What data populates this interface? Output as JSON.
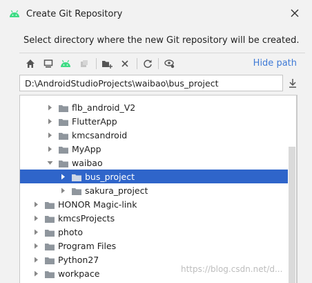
{
  "window": {
    "title": "Create Git Repository",
    "subtitle": "Select directory where the new Git repository will be created."
  },
  "toolbar": {
    "icons": [
      "home-icon",
      "desktop-icon",
      "android-project-icon",
      "module-icon",
      "new-folder-icon",
      "delete-icon",
      "refresh-icon",
      "show-hidden-icon"
    ],
    "hide_path_label": "Hide path"
  },
  "path": {
    "value": "D:\\AndroidStudioProjects\\waibao\\bus_project"
  },
  "tree": {
    "items": [
      {
        "label": "flb_android_V2",
        "expanded": false,
        "selected": false
      },
      {
        "label": "FlutterApp",
        "expanded": false,
        "selected": false
      },
      {
        "label": "kmcsandroid",
        "expanded": false,
        "selected": false
      },
      {
        "label": "MyApp",
        "expanded": false,
        "selected": false
      },
      {
        "label": "waibao",
        "expanded": true,
        "selected": false
      },
      {
        "label": "bus_project",
        "expanded": false,
        "selected": true
      },
      {
        "label": "sakura_project",
        "expanded": false,
        "selected": false
      },
      {
        "label": "HONOR Magic-link",
        "expanded": false,
        "selected": false
      },
      {
        "label": "kmcsProjects",
        "expanded": false,
        "selected": false
      },
      {
        "label": "photo",
        "expanded": false,
        "selected": false
      },
      {
        "label": "Program Files",
        "expanded": false,
        "selected": false
      },
      {
        "label": "Python27",
        "expanded": false,
        "selected": false
      },
      {
        "label": "workpace",
        "expanded": false,
        "selected": false
      }
    ]
  },
  "watermark": "https://blog.csdn.net/d...",
  "colors": {
    "selection": "#2f65ca",
    "link": "#3f7ad6",
    "folder": "#8f969d",
    "android": "#3ddc84"
  }
}
